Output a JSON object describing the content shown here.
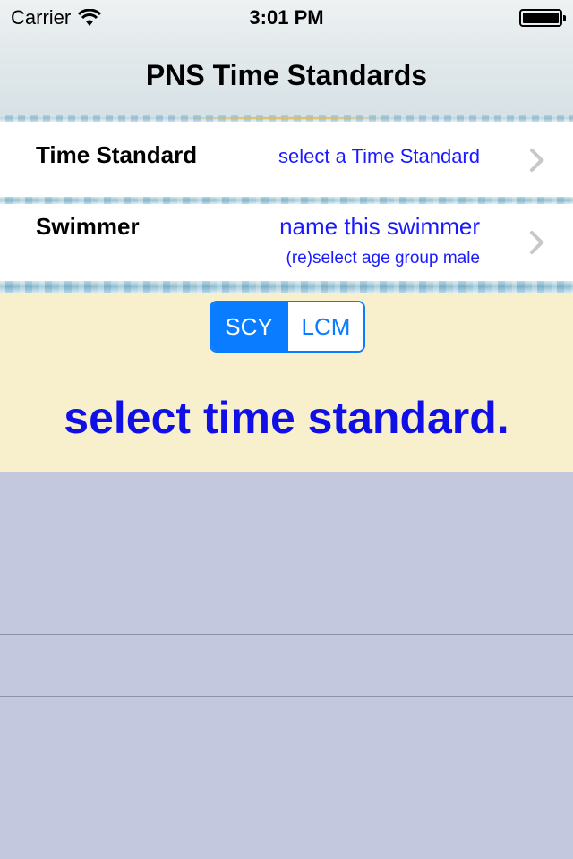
{
  "status_bar": {
    "carrier": "Carrier",
    "time": "3:01 PM",
    "wifi_icon": "wifi-icon",
    "battery_icon": "battery-icon",
    "battery_level": 1.0
  },
  "nav": {
    "title": "PNS Time Standards"
  },
  "cells": {
    "time_standard": {
      "label": "Time Standard",
      "value": "select a Time Standard",
      "chevron_icon": "chevron-right-icon"
    },
    "swimmer": {
      "label": "Swimmer",
      "value": "name this swimmer",
      "subvalue": "(re)select age group male",
      "chevron_icon": "chevron-right-icon"
    }
  },
  "course_selector": {
    "options": [
      "SCY",
      "LCM"
    ],
    "selected": "SCY"
  },
  "message": "select time standard.",
  "colors": {
    "accent": "#0a7cff",
    "link_text": "#1a1aff",
    "message_text": "#1010e6",
    "panel_bg": "#f8f0cc",
    "table_bg": "#c4c8de"
  }
}
